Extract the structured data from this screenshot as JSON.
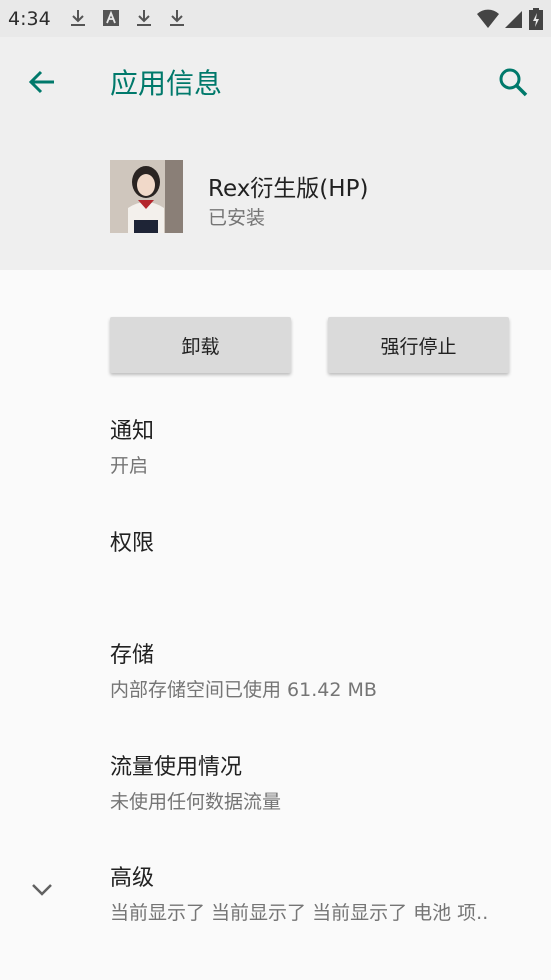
{
  "status_bar": {
    "time": "4:34",
    "left_icons": [
      "download-icon",
      "app-notification-icon",
      "download-icon",
      "download-icon"
    ],
    "right_icons": [
      "wifi-icon",
      "signal-icon",
      "battery-charging-icon"
    ]
  },
  "header": {
    "title": "应用信息",
    "back_icon": "arrow-back-icon",
    "search_icon": "search-icon",
    "accent_color": "#00796b"
  },
  "app": {
    "name": "Rex衍生版(HP)",
    "status": "已安装"
  },
  "buttons": {
    "uninstall": "卸载",
    "force_stop": "强行停止"
  },
  "prefs": {
    "notifications": {
      "title": "通知",
      "summary": "开启"
    },
    "permissions": {
      "title": "权限"
    },
    "storage": {
      "title": "存储",
      "summary": "内部存储空间已使用 61.42 MB"
    },
    "data_usage": {
      "title": "流量使用情况",
      "summary": "未使用任何数据流量"
    },
    "advanced": {
      "title": "高级",
      "summary": "当前显示了 当前显示了 当前显示了 电池 项.."
    }
  }
}
